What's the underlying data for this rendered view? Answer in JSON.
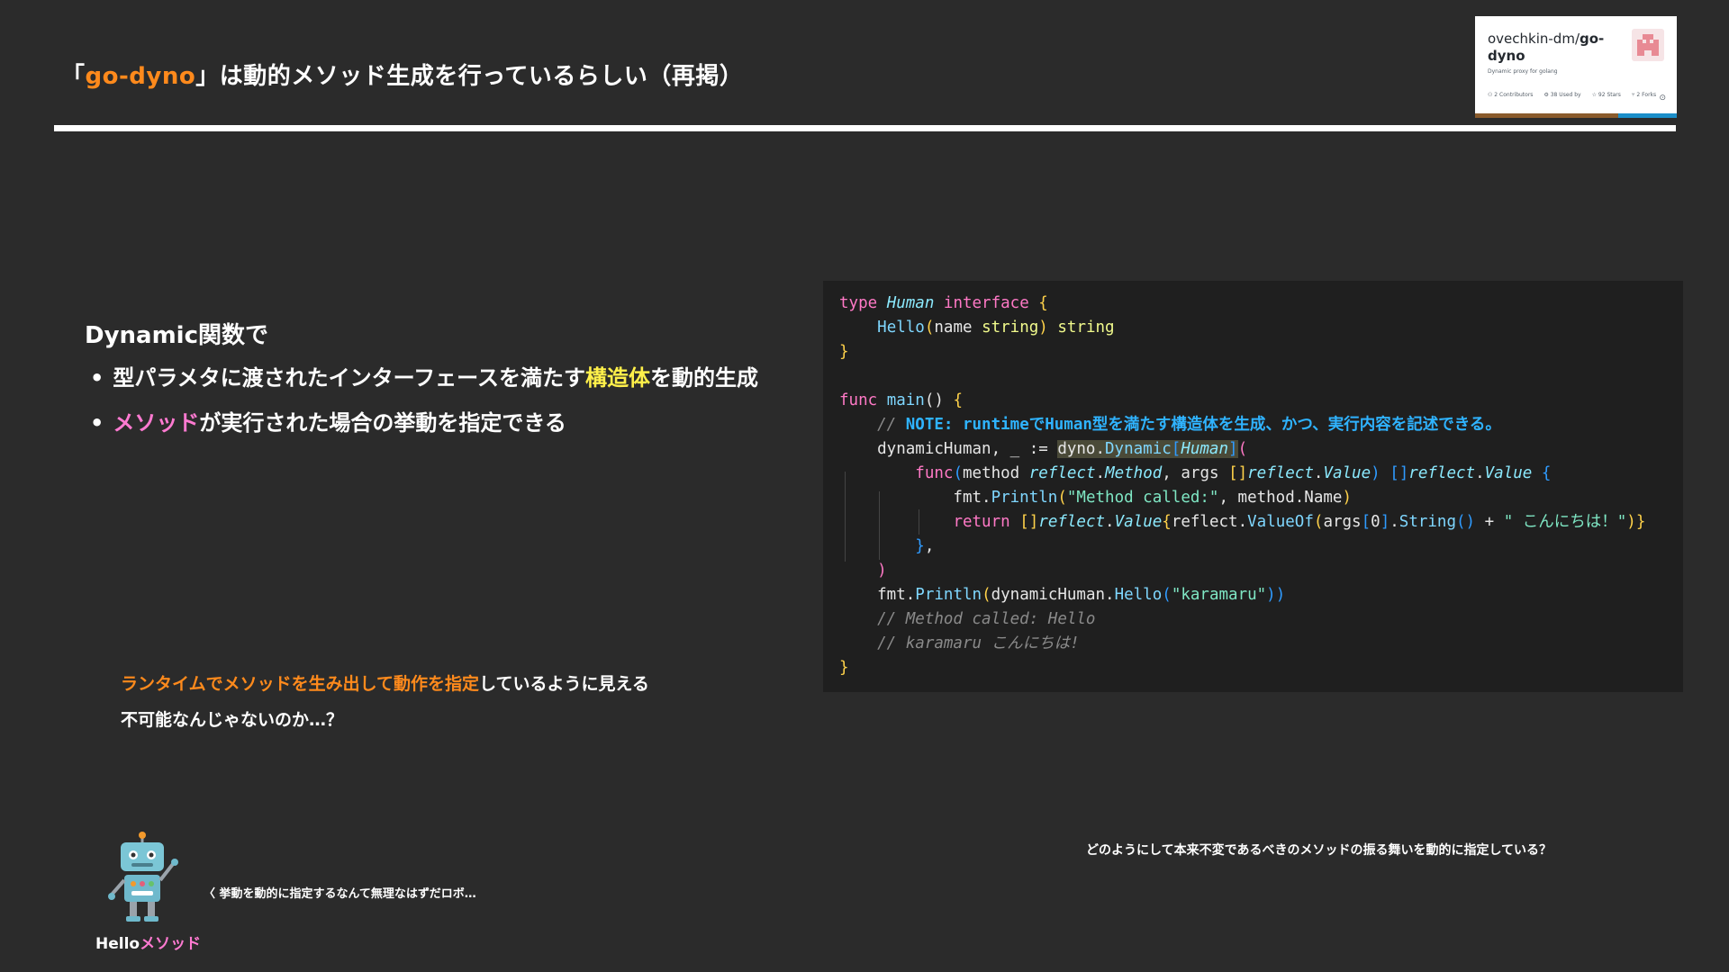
{
  "slide": {
    "title": {
      "open_bracket": "「",
      "highlight": "go-dyno",
      "rest": "」は動的メソッド生成を行っているらしい（再掲）"
    },
    "lead": "Dynamic関数で",
    "bullets": [
      {
        "parts": [
          {
            "text": "型パラメタに渡されたインターフェースを満たす",
            "color": "white"
          },
          {
            "text": "構造体",
            "color": "yellow"
          },
          {
            "text": "を動的生成",
            "color": "white"
          }
        ]
      },
      {
        "parts": [
          {
            "text": "メソッド",
            "color": "pink"
          },
          {
            "text": "が実行された場合の挙動を指定できる",
            "color": "white"
          }
        ]
      }
    ],
    "note": {
      "line1_highlight": "ランタイムでメソッドを生み出して動作を指定",
      "line1_rest": "しているように見える",
      "line2": "不可能なんじゃないのか…？"
    },
    "question": "どのようにして本来不変であるべきのメソッドの振る舞いを動的に指定している？",
    "robot": {
      "label_plain": "Hello",
      "label_highlight": "メソッド",
      "speech": "〈 挙動を動的に指定するなんて無理なはずだロボ…"
    }
  },
  "repo_card": {
    "owner": "ovechkin-dm/",
    "repo": "go-dyno",
    "description": "Dynamic proxy for golang",
    "stats": [
      {
        "value": "2",
        "label": "Contributors"
      },
      {
        "value": "38",
        "label": "Used by"
      },
      {
        "value": "92",
        "label": "Stars"
      },
      {
        "value": "2",
        "label": "Forks"
      }
    ]
  },
  "code": {
    "lines": [
      [
        {
          "t": "type ",
          "c": "kw"
        },
        {
          "t": "Human",
          "c": "type"
        },
        {
          "t": " interface ",
          "c": "kw"
        },
        {
          "t": "{",
          "c": "brace"
        }
      ],
      [
        {
          "t": "    ",
          "c": "plain"
        },
        {
          "t": "Hello",
          "c": "fn"
        },
        {
          "t": "(",
          "c": "brace"
        },
        {
          "t": "name ",
          "c": "plain"
        },
        {
          "t": "string",
          "c": "gold"
        },
        {
          "t": ")",
          "c": "brace"
        },
        {
          "t": " string",
          "c": "gold"
        }
      ],
      [
        {
          "t": "}",
          "c": "brace"
        }
      ],
      [
        {
          "t": "",
          "c": "plain"
        }
      ],
      [
        {
          "t": "func ",
          "c": "kw"
        },
        {
          "t": "main",
          "c": "fn"
        },
        {
          "t": "() ",
          "c": "plain"
        },
        {
          "t": "{",
          "c": "brace"
        }
      ],
      [
        {
          "t": "    // ",
          "c": "comment"
        },
        {
          "t": "NOTE: runtimeでHuman型を満たす構造体を生成、かつ、実行内容を記述できる。",
          "c": "note"
        }
      ],
      [
        {
          "t": "    dynamicHuman, _ := ",
          "c": "plain"
        },
        {
          "t": "dyno.",
          "c": "hl-plain"
        },
        {
          "t": "Dynamic",
          "c": "hl-fn"
        },
        {
          "t": "[",
          "c": "hl-blue"
        },
        {
          "t": "Human",
          "c": "hl-type"
        },
        {
          "t": "]",
          "c": "hl-blue"
        },
        {
          "t": "(",
          "c": "kw"
        }
      ],
      [
        {
          "t": "        ",
          "c": "plain"
        },
        {
          "t": "func",
          "c": "kw"
        },
        {
          "t": "(",
          "c": "blue"
        },
        {
          "t": "method ",
          "c": "plain"
        },
        {
          "t": "reflect",
          "c": "type"
        },
        {
          "t": ".",
          "c": "plain"
        },
        {
          "t": "Method",
          "c": "type"
        },
        {
          "t": ", args ",
          "c": "plain"
        },
        {
          "t": "[]",
          "c": "brace"
        },
        {
          "t": "reflect",
          "c": "type"
        },
        {
          "t": ".",
          "c": "plain"
        },
        {
          "t": "Value",
          "c": "type"
        },
        {
          "t": ") ",
          "c": "blue"
        },
        {
          "t": "[]",
          "c": "blue"
        },
        {
          "t": "reflect",
          "c": "type"
        },
        {
          "t": ".",
          "c": "plain"
        },
        {
          "t": "Value",
          "c": "type"
        },
        {
          "t": " {",
          "c": "blue"
        }
      ],
      [
        {
          "t": "            fmt.",
          "c": "plain"
        },
        {
          "t": "Println",
          "c": "fn"
        },
        {
          "t": "(",
          "c": "brace"
        },
        {
          "t": "\"Method called:\"",
          "c": "string"
        },
        {
          "t": ", method.Name",
          "c": "plain"
        },
        {
          "t": ")",
          "c": "brace"
        }
      ],
      [
        {
          "t": "            ",
          "c": "plain"
        },
        {
          "t": "return ",
          "c": "kw"
        },
        {
          "t": "[]",
          "c": "brace"
        },
        {
          "t": "reflect",
          "c": "type"
        },
        {
          "t": ".",
          "c": "plain"
        },
        {
          "t": "Value",
          "c": "type"
        },
        {
          "t": "{",
          "c": "brace"
        },
        {
          "t": "reflect.",
          "c": "plain"
        },
        {
          "t": "ValueOf",
          "c": "fn"
        },
        {
          "t": "(",
          "c": "brace"
        },
        {
          "t": "args",
          "c": "plain"
        },
        {
          "t": "[",
          "c": "blue"
        },
        {
          "t": "0",
          "c": "plain"
        },
        {
          "t": "]",
          "c": "blue"
        },
        {
          "t": ".",
          "c": "plain"
        },
        {
          "t": "String",
          "c": "fn"
        },
        {
          "t": "()",
          "c": "blue"
        },
        {
          "t": " + ",
          "c": "plain"
        },
        {
          "t": "\" こんにちは！\"",
          "c": "string"
        },
        {
          "t": ")}",
          "c": "brace"
        }
      ],
      [
        {
          "t": "        ",
          "c": "plain"
        },
        {
          "t": "}",
          "c": "blue"
        },
        {
          "t": ",",
          "c": "plain"
        }
      ],
      [
        {
          "t": "    ",
          "c": "plain"
        },
        {
          "t": ")",
          "c": "kw"
        }
      ],
      [
        {
          "t": "    fmt.",
          "c": "plain"
        },
        {
          "t": "Println",
          "c": "fn"
        },
        {
          "t": "(",
          "c": "brace"
        },
        {
          "t": "dynamicHuman.",
          "c": "plain"
        },
        {
          "t": "Hello",
          "c": "fn"
        },
        {
          "t": "(",
          "c": "blue"
        },
        {
          "t": "\"karamaru\"",
          "c": "string"
        },
        {
          "t": "))",
          "c": "blue"
        }
      ],
      [
        {
          "t": "    // Method called: Hello",
          "c": "comment"
        }
      ],
      [
        {
          "t": "    // karamaru こんにちは!",
          "c": "comment"
        }
      ],
      [
        {
          "t": "}",
          "c": "brace"
        }
      ]
    ]
  }
}
